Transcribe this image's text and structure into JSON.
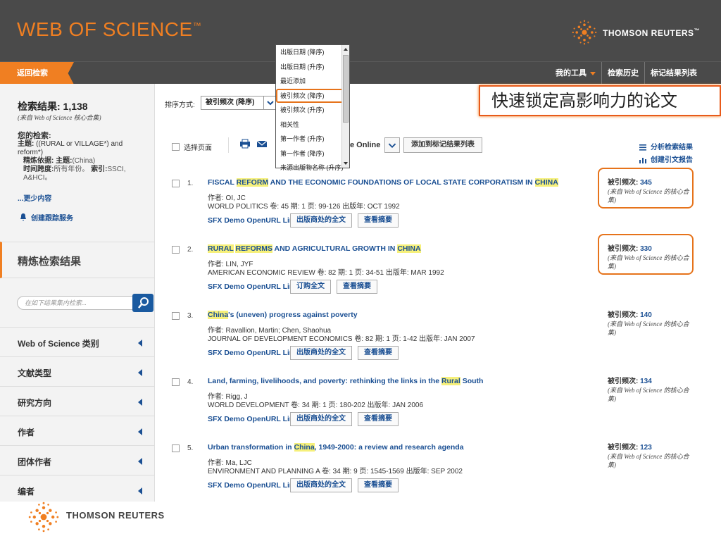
{
  "header": {
    "logo_text": "WEB OF SCIENCE",
    "logo_tm": "™",
    "publisher": "THOMSON REUTERS",
    "publisher_tm": "™"
  },
  "navbar": {
    "back": "返回检索",
    "my_tools": "我的工具",
    "history": "检索历史",
    "marked": "标记结果列表"
  },
  "sidebar": {
    "results_label": "检索结果: 1,138",
    "results_source": "(来自 Web of Science 核心合集)",
    "your_search_label": "您的检索:",
    "topic_label": "主题:",
    "topic_value": "((RURAL or VILLAGE*) and reform*)",
    "refined_label": "精炼依据:",
    "refined_topic_label": "主题:",
    "refined_topic_value": "(China)",
    "timespan_label": "时间跨度:",
    "timespan_value": "所有年份。",
    "index_label": "索引:",
    "index_value": "SSCI, A&HCI。",
    "less_link": "...更少内容",
    "alert": "创建跟踪服务",
    "refine_title": "精炼检索结果",
    "search_within_placeholder": "在如下结果集内检索...",
    "facets": [
      "Web of Science 类别",
      "文献类型",
      "研究方向",
      "作者",
      "团体作者",
      "编者"
    ]
  },
  "sort": {
    "label": "排序方式:",
    "selected": "被引频次 (降序)",
    "options": [
      "出版日期 (降序)",
      "出版日期 (升序)",
      "最近添加",
      "被引频次 (降序)",
      "被引频次 (升序)",
      "相关性",
      "第一作者 (升序)",
      "第一作者 (降序)",
      "来源出版物名称 (升序)"
    ]
  },
  "callout": "快速锁定高影响力的论文",
  "toolbar": {
    "select_page": "选择页面",
    "save_online": "e Online",
    "add_marked": "添加到标记结果列表",
    "analyze": "分析检索结果",
    "citation_report": "创建引文报告"
  },
  "records": [
    {
      "num": "1.",
      "title_parts": [
        {
          "t": "FISCAL ",
          "h": false
        },
        {
          "t": "REFORM",
          "h": true
        },
        {
          "t": " AND THE ECONOMIC FOUNDATIONS OF LOCAL STATE CORPORATISM IN ",
          "h": false
        },
        {
          "t": "CHINA",
          "h": true
        }
      ],
      "authors": "作者: OI, JC",
      "source": "WORLD POLITICS  卷: 45   期: 1   页: 99-126   出版年: OCT 1992",
      "sfx": "SFX Demo OpenURL Link",
      "btn1": "出版商处的全文",
      "btn2": "查看摘要",
      "cite_label": "被引频次:",
      "cite_count": "345",
      "cite_src": "(来自 Web of Science 的核心合集)"
    },
    {
      "num": "2.",
      "title_parts": [
        {
          "t": "RURAL",
          "h": true
        },
        {
          "t": " ",
          "h": false
        },
        {
          "t": "REFORMS",
          "h": true
        },
        {
          "t": " AND AGRICULTURAL GROWTH IN ",
          "h": false
        },
        {
          "t": "CHINA",
          "h": true
        }
      ],
      "authors": "作者: LIN, JYF",
      "source": "AMERICAN ECONOMIC REVIEW  卷: 82   期: 1   页: 34-51   出版年: MAR 1992",
      "sfx": "SFX Demo OpenURL Link",
      "btn1": "订购全文",
      "btn2": "查看摘要",
      "cite_label": "被引频次:",
      "cite_count": "330",
      "cite_src": "(来自 Web of Science 的核心合集)"
    },
    {
      "num": "3.",
      "title_parts": [
        {
          "t": "China",
          "h": true
        },
        {
          "t": "'s (uneven) progress against poverty",
          "h": false
        }
      ],
      "authors": "作者: Ravallion, Martin; Chen, Shaohua",
      "source": "JOURNAL OF DEVELOPMENT ECONOMICS  卷: 82   期: 1   页: 1-42   出版年: JAN 2007",
      "sfx": "SFX Demo OpenURL Link",
      "btn1": "出版商处的全文",
      "btn2": "查看摘要",
      "cite_label": "被引频次:",
      "cite_count": "140",
      "cite_src": "(来自 Web of Science 的核心合集)"
    },
    {
      "num": "4.",
      "title_parts": [
        {
          "t": "Land, farming, livelihoods, and poverty: rethinking the links in the ",
          "h": false
        },
        {
          "t": "Rural",
          "h": true
        },
        {
          "t": " South",
          "h": false
        }
      ],
      "authors": "作者: Rigg, J",
      "source": "WORLD DEVELOPMENT  卷: 34   期: 1   页: 180-202   出版年: JAN 2006",
      "sfx": "SFX Demo OpenURL Link",
      "btn1": "出版商处的全文",
      "btn2": "查看摘要",
      "cite_label": "被引频次:",
      "cite_count": "134",
      "cite_src": "(来自 Web of Science 的核心合集)"
    },
    {
      "num": "5.",
      "title_parts": [
        {
          "t": "Urban transformation in ",
          "h": false
        },
        {
          "t": "China",
          "h": true
        },
        {
          "t": ", 1949-2000: a review and research agenda",
          "h": false
        }
      ],
      "authors": "作者: Ma, LJC",
      "source": "ENVIRONMENT AND PLANNING A  卷: 34   期: 9   页: 1545-1569   出版年: SEP 2002",
      "sfx": "SFX Demo OpenURL Link",
      "btn1": "出版商处的全文",
      "btn2": "查看摘要",
      "cite_label": "被引频次:",
      "cite_count": "123",
      "cite_src": "(来自 Web of Science 的核心合集)"
    }
  ],
  "footer": {
    "publisher": "THOMSON REUTERS"
  },
  "colors": {
    "accent": "#f07f22",
    "link": "#1a4f93",
    "highlight": "#f6f07a",
    "header_bg": "#4a4a4a"
  }
}
